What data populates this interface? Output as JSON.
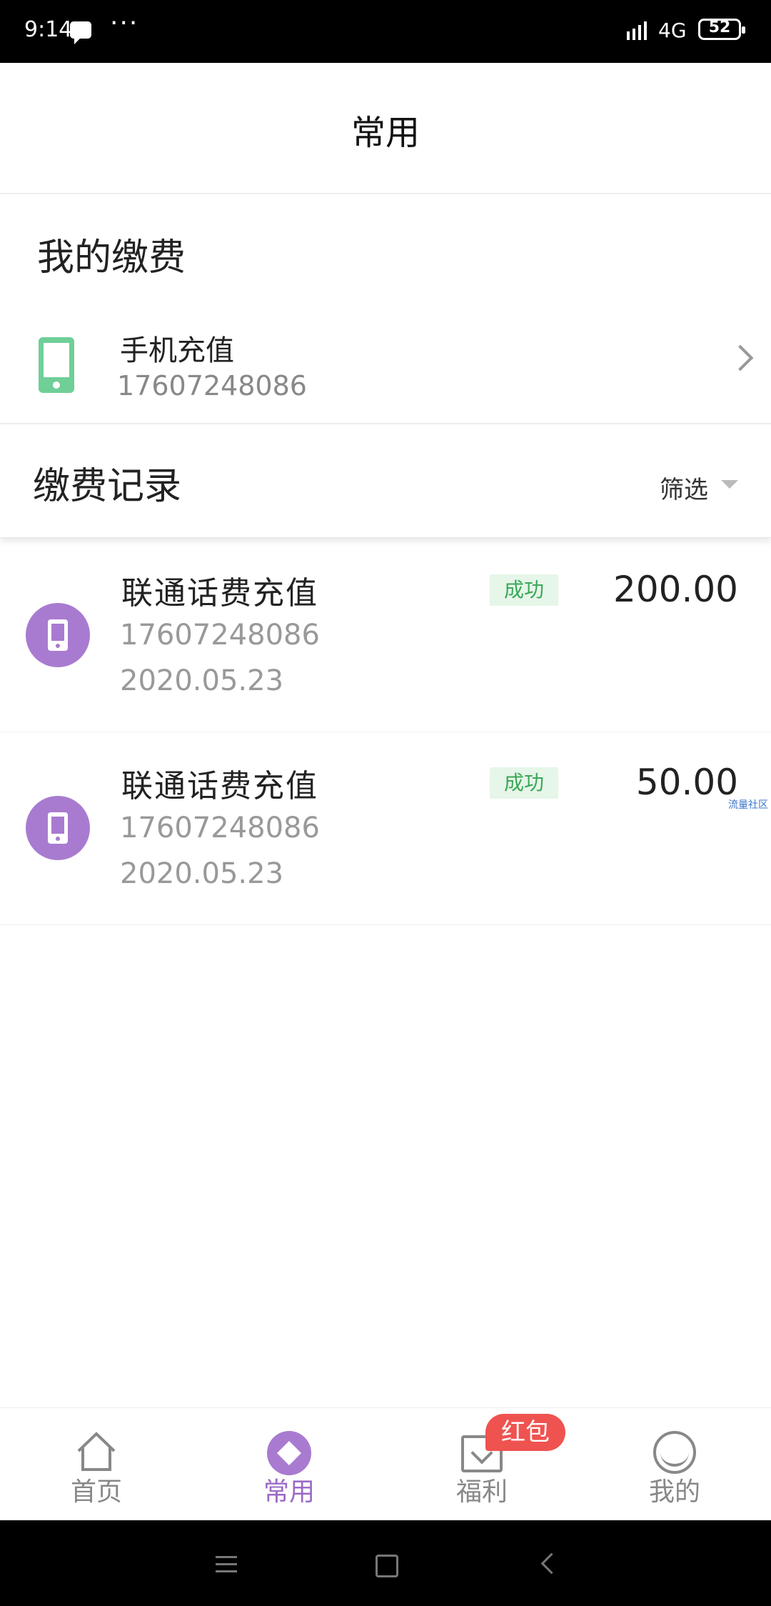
{
  "status_bar": {
    "time": "9:14",
    "network": "4G",
    "battery": "52"
  },
  "header": {
    "title": "常用"
  },
  "my_payment": {
    "title": "我的缴费",
    "item": {
      "label": "手机充值",
      "number": "17607248086"
    }
  },
  "records": {
    "title": "缴费记录",
    "filter_label": "筛选",
    "items": [
      {
        "name": "联通话费充值",
        "phone": "17607248086",
        "date": "2020.05.23",
        "status": "成功",
        "amount": "200.00"
      },
      {
        "name": "联通话费充值",
        "phone": "17607248086",
        "date": "2020.05.23",
        "status": "成功",
        "amount": "50.00"
      }
    ]
  },
  "watermark": "流量社区",
  "tabbar": {
    "items": [
      {
        "label": "首页",
        "icon": "home-icon"
      },
      {
        "label": "常用",
        "icon": "diamond-icon"
      },
      {
        "label": "福利",
        "icon": "gift-bag-icon"
      },
      {
        "label": "我的",
        "icon": "smile-icon"
      }
    ],
    "badge": "红包",
    "active": "常用"
  },
  "colors": {
    "accent": "#a87bd0",
    "success": "#3aa858",
    "success_bg": "#e6f6e9",
    "badge": "#ef5350",
    "phone_icon": "#6fcf97"
  }
}
